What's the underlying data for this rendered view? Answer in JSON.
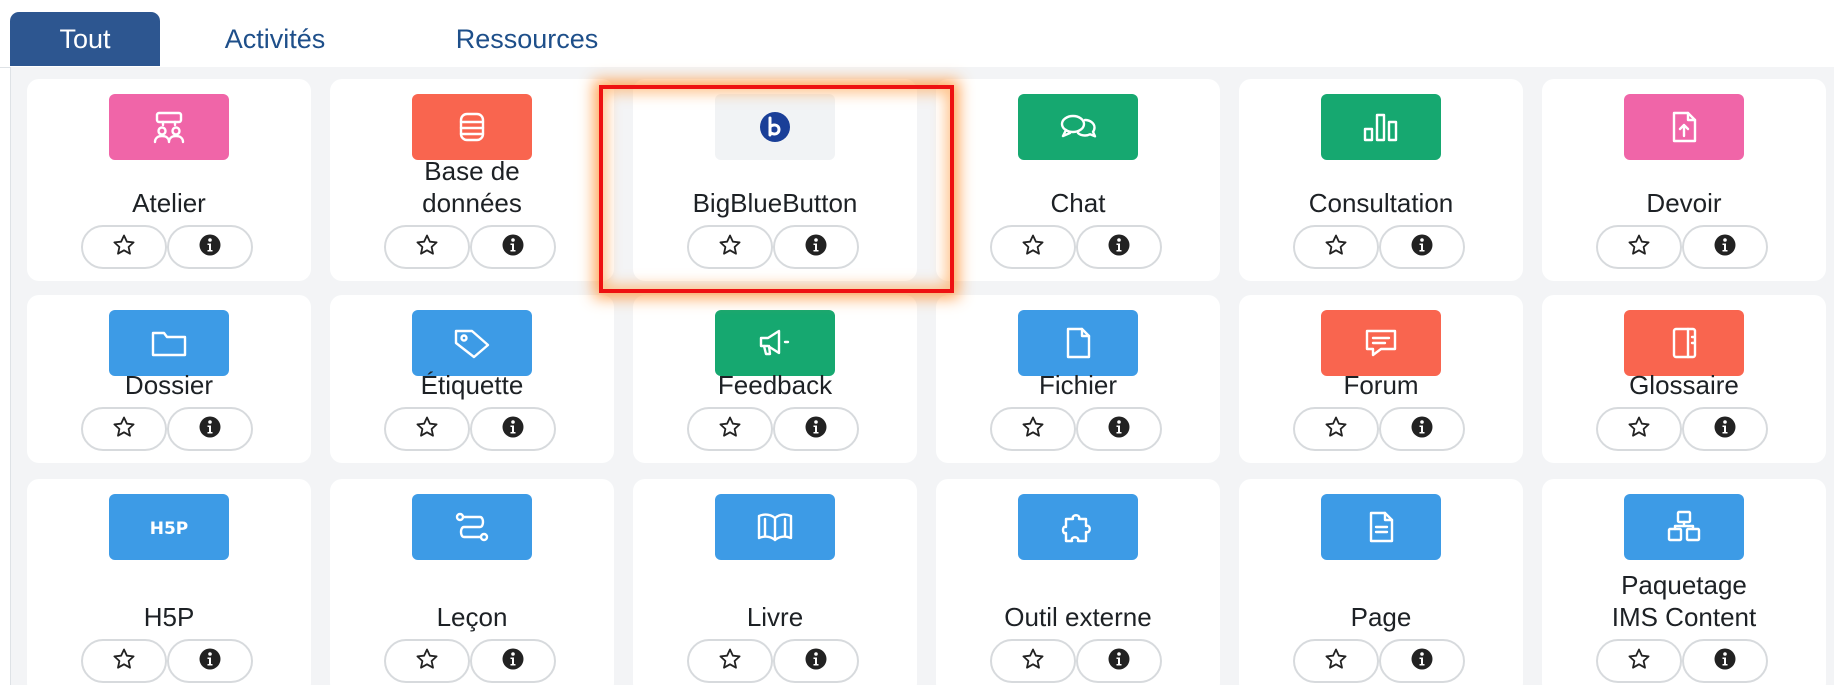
{
  "tabs": [
    {
      "label": "Tout",
      "active": true
    },
    {
      "label": "Activités",
      "active": false
    },
    {
      "label": "Ressources",
      "active": false
    }
  ],
  "modules": [
    {
      "id": "atelier",
      "label": "Atelier",
      "color": "#f065a8",
      "icon": "workshop-icon"
    },
    {
      "id": "base-de-donnees",
      "label": "Base de\ndonnées",
      "color": "#f9654f",
      "icon": "database-icon"
    },
    {
      "id": "bigbluebutton",
      "label": "BigBlueButton",
      "color": "#f1f3f5",
      "icon": "bigbluebutton-logo-icon",
      "highlighted": true
    },
    {
      "id": "chat",
      "label": "Chat",
      "color": "#16a870",
      "icon": "chat-bubbles-icon"
    },
    {
      "id": "consultation",
      "label": "Consultation",
      "color": "#16a870",
      "icon": "bar-chart-icon"
    },
    {
      "id": "devoir",
      "label": "Devoir",
      "color": "#f065a8",
      "icon": "file-upload-icon"
    },
    {
      "id": "dossier",
      "label": "Dossier",
      "color": "#3d9be6",
      "icon": "folder-icon"
    },
    {
      "id": "etiquette",
      "label": "Étiquette",
      "color": "#3d9be6",
      "icon": "tag-icon"
    },
    {
      "id": "feedback",
      "label": "Feedback",
      "color": "#16a870",
      "icon": "megaphone-icon"
    },
    {
      "id": "fichier",
      "label": "Fichier",
      "color": "#3d9be6",
      "icon": "file-icon"
    },
    {
      "id": "forum",
      "label": "Forum",
      "color": "#f9654f",
      "icon": "forum-message-icon"
    },
    {
      "id": "glossaire",
      "label": "Glossaire",
      "color": "#f9654f",
      "icon": "glossary-book-icon"
    },
    {
      "id": "h5p",
      "label": "H5P",
      "color": "#3d9be6",
      "icon": "h5p-icon"
    },
    {
      "id": "lecon",
      "label": "Leçon",
      "color": "#3d9be6",
      "icon": "lesson-path-icon"
    },
    {
      "id": "livre",
      "label": "Livre",
      "color": "#3d9be6",
      "icon": "open-book-icon"
    },
    {
      "id": "outil-externe",
      "label": "Outil externe",
      "color": "#3d9be6",
      "icon": "puzzle-icon"
    },
    {
      "id": "page",
      "label": "Page",
      "color": "#3d9be6",
      "icon": "page-document-icon"
    },
    {
      "id": "paquetage-ims",
      "label": "Paquetage\nIMS Content",
      "color": "#3d9be6",
      "icon": "package-boxes-icon"
    }
  ],
  "buttons": {
    "star_icon": "star-outline-icon",
    "info_icon": "info-circle-icon"
  },
  "highlight_color": "#ee1111"
}
